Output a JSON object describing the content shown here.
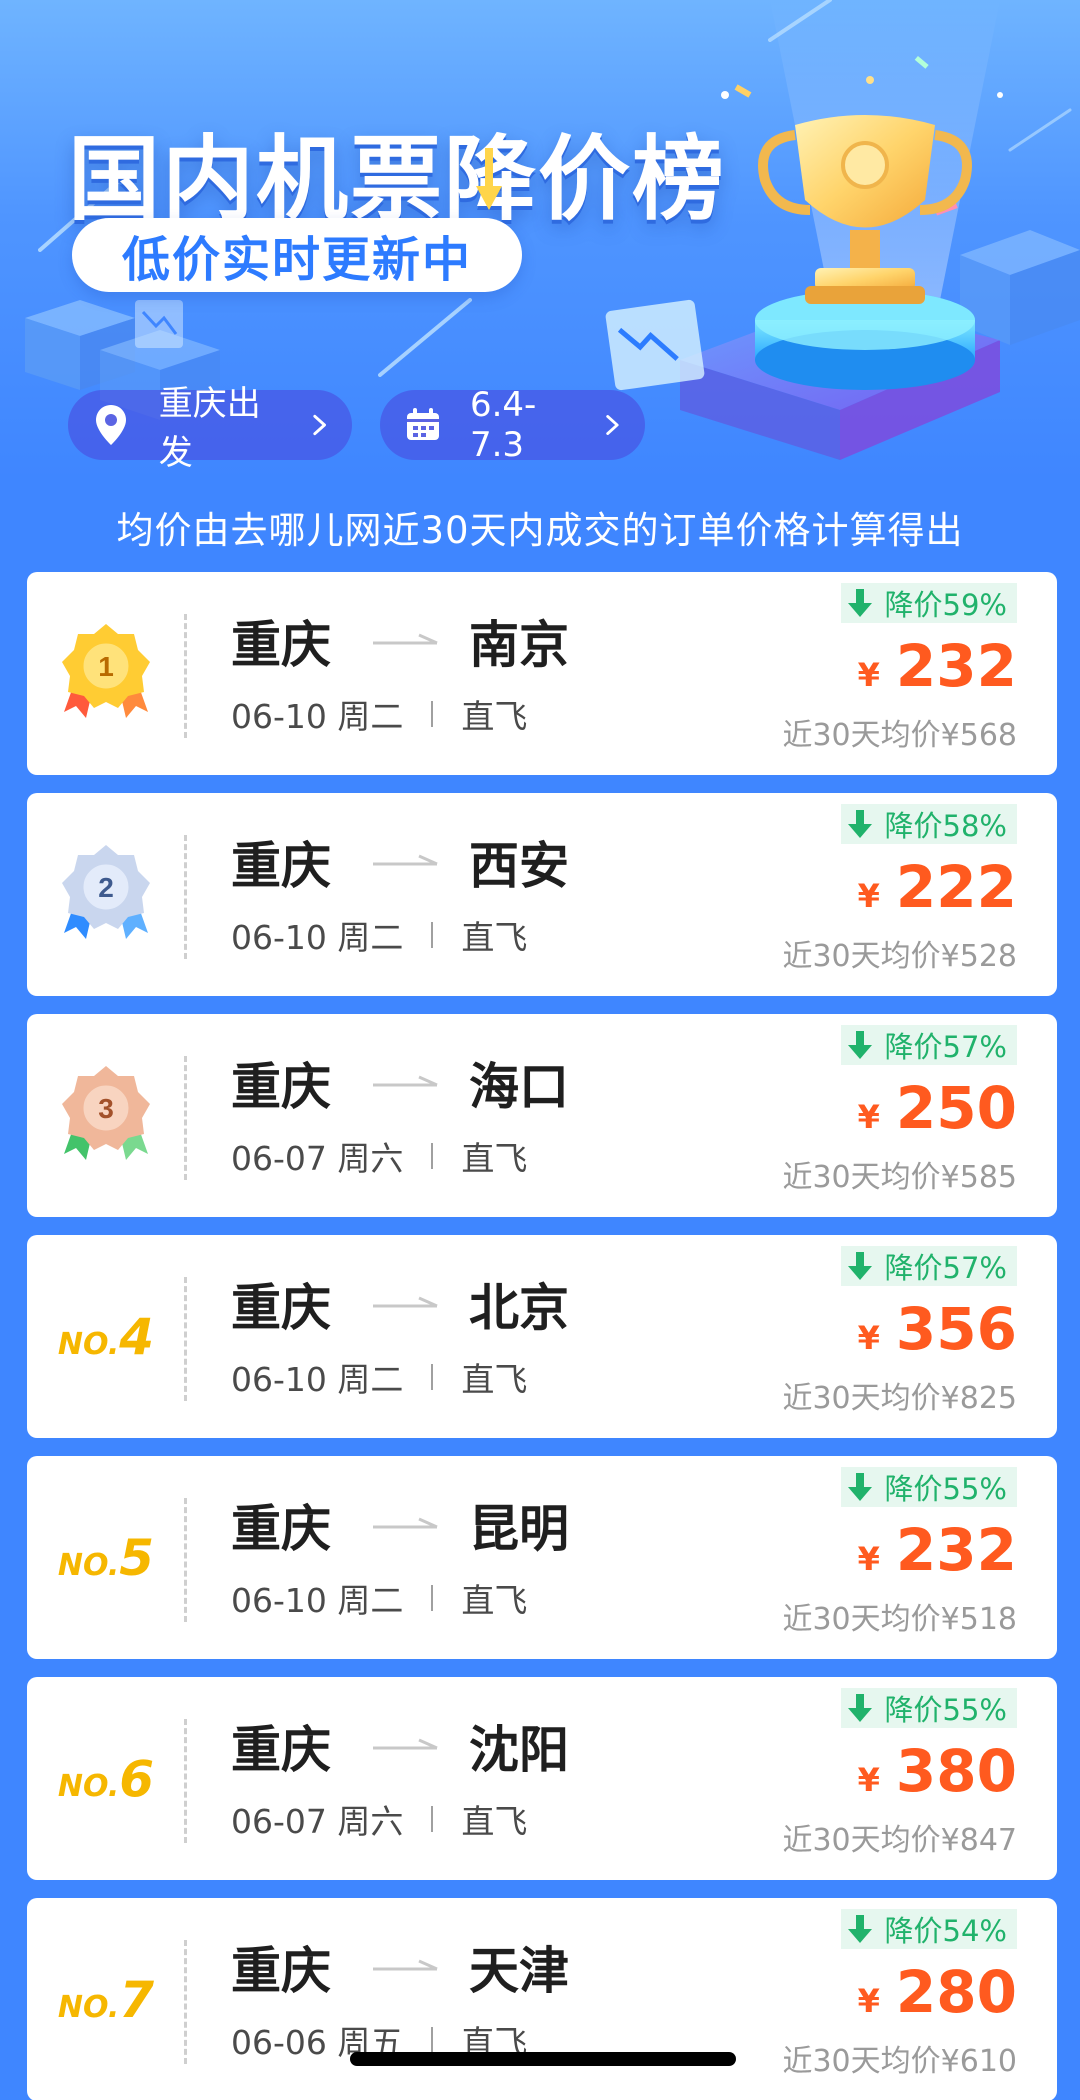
{
  "header": {
    "title": "国内机票降价榜",
    "subtitle": "低价实时更新中",
    "departure_label": "重庆出发",
    "date_range_label": "6.4-7.3"
  },
  "note": "均价由去哪儿网近30天内成交的订单价格计算得出",
  "colors": {
    "background": "#3f86ff",
    "price": "#ff5a1f",
    "drop_text": "#20b26b",
    "drop_bg": "#e6f7ef",
    "rank_gold": "#f6b700"
  },
  "rank_prefix": "NO.",
  "currency_symbol": "¥",
  "routes": [
    {
      "rank": "1",
      "rank_display": "medal-gold",
      "from": "重庆",
      "to": "南京",
      "date": "06-10 周二",
      "flight_type": "直飞",
      "drop": "降价59%",
      "price": "232",
      "avg": "近30天均价¥568"
    },
    {
      "rank": "2",
      "rank_display": "medal-silver",
      "from": "重庆",
      "to": "西安",
      "date": "06-10 周二",
      "flight_type": "直飞",
      "drop": "降价58%",
      "price": "222",
      "avg": "近30天均价¥528"
    },
    {
      "rank": "3",
      "rank_display": "medal-bronze",
      "from": "重庆",
      "to": "海口",
      "date": "06-07 周六",
      "flight_type": "直飞",
      "drop": "降价57%",
      "price": "250",
      "avg": "近30天均价¥585"
    },
    {
      "rank": "4",
      "rank_display": "text",
      "from": "重庆",
      "to": "北京",
      "date": "06-10 周二",
      "flight_type": "直飞",
      "drop": "降价57%",
      "price": "356",
      "avg": "近30天均价¥825"
    },
    {
      "rank": "5",
      "rank_display": "text",
      "from": "重庆",
      "to": "昆明",
      "date": "06-10 周二",
      "flight_type": "直飞",
      "drop": "降价55%",
      "price": "232",
      "avg": "近30天均价¥518"
    },
    {
      "rank": "6",
      "rank_display": "text",
      "from": "重庆",
      "to": "沈阳",
      "date": "06-07 周六",
      "flight_type": "直飞",
      "drop": "降价55%",
      "price": "380",
      "avg": "近30天均价¥847"
    },
    {
      "rank": "7",
      "rank_display": "text",
      "from": "重庆",
      "to": "天津",
      "date": "06-06 周五",
      "flight_type": "直飞",
      "drop": "降价54%",
      "price": "280",
      "avg": "近30天均价¥610"
    }
  ]
}
